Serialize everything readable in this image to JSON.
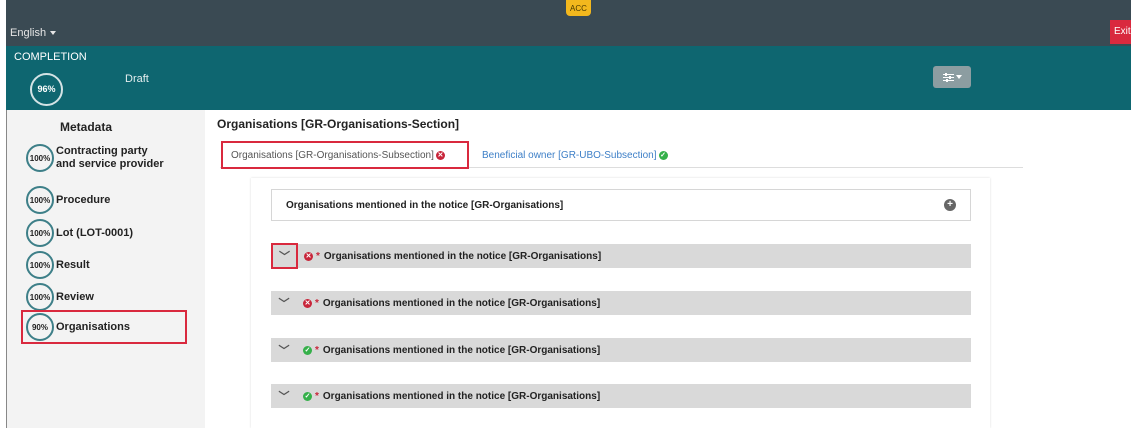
{
  "header": {
    "language": "English",
    "env_badge": "ACC",
    "exit_label": "Exit"
  },
  "completion": {
    "label": "COMPLETION",
    "percent": "96%",
    "status": "Draft",
    "filter_icon": "sliders-icon"
  },
  "sidebar": {
    "title": "Metadata",
    "items": [
      {
        "pct": "100%",
        "label": "Contracting party and service provider"
      },
      {
        "pct": "100%",
        "label": "Procedure"
      },
      {
        "pct": "100%",
        "label": "Lot (LOT-0001)"
      },
      {
        "pct": "100%",
        "label": "Result"
      },
      {
        "pct": "100%",
        "label": "Review"
      },
      {
        "pct": "90%",
        "label": "Organisations"
      }
    ]
  },
  "main": {
    "section_title": "Organisations [GR-Organisations-Section]",
    "tabs": [
      {
        "label": "Organisations  [GR-Organisations-Subsection]",
        "status": "error"
      },
      {
        "label": "Beneficial owner  [GR-UBO-Subsection]",
        "status": "ok"
      }
    ],
    "group_header": "Organisations mentioned in the notice  [GR-Organisations]",
    "rows": [
      {
        "label": "Organisations mentioned in the notice  [GR-Organisations]",
        "status": "error",
        "required": "*"
      },
      {
        "label": "Organisations mentioned in the notice  [GR-Organisations]",
        "status": "error",
        "required": "*"
      },
      {
        "label": "Organisations mentioned in the notice  [GR-Organisations]",
        "status": "ok",
        "required": "*"
      },
      {
        "label": "Organisations mentioned in the notice  [GR-Organisations]",
        "status": "ok",
        "required": "*"
      }
    ]
  },
  "colors": {
    "topbar": "#3a4a53",
    "teal": "#0e6670",
    "accent_red": "#d9293e",
    "badge_yellow": "#f3b81d",
    "link_blue": "#3d7fc7",
    "error_icon": "#c8253a",
    "ok_icon": "#35b04a"
  }
}
